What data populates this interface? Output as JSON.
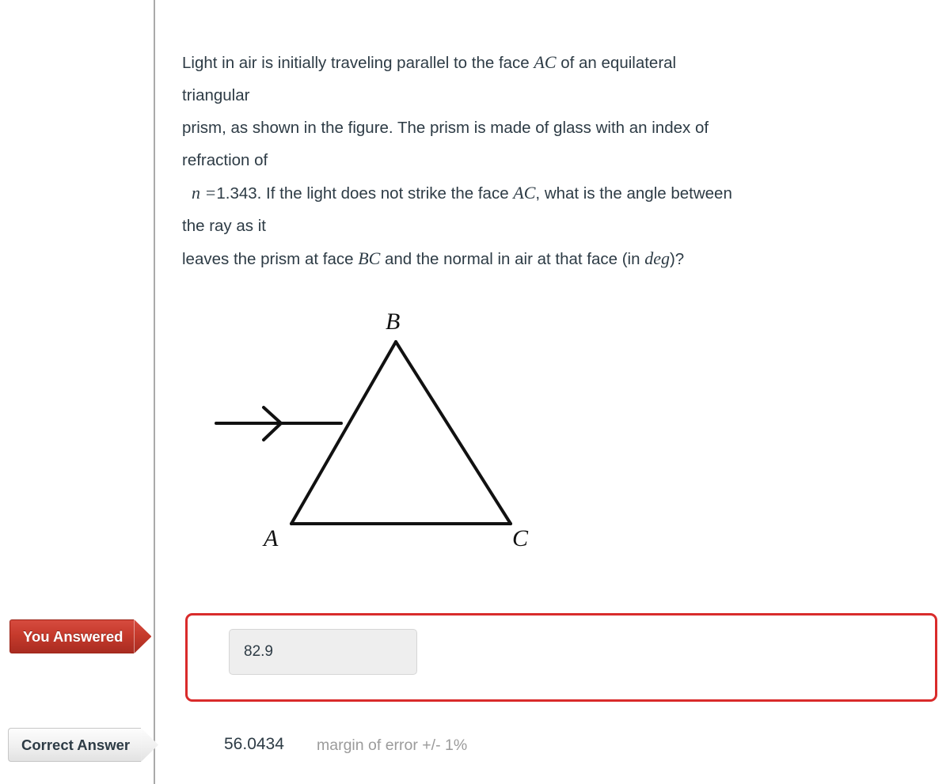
{
  "question": {
    "lines": [
      {
        "id": "l1",
        "pre": "Light in air is initially traveling parallel to the  face ",
        "math": "AC",
        "post": " of an equilateral"
      },
      {
        "id": "l2",
        "pre": "triangular",
        "math": "",
        "post": ""
      },
      {
        "id": "l3",
        "pre": "prism, as shown in the figure. The prism is made of glass with an index of",
        "math": "",
        "post": ""
      },
      {
        "id": "l4",
        "pre": "refraction of",
        "math": "",
        "post": ""
      },
      {
        "id": "l5",
        "pre": "",
        "math": "n =",
        "post": "1.343.  If the light does not strike the face ",
        "math2": "AC",
        "post2": ", what is the angle between"
      },
      {
        "id": "l6",
        "pre": "the ray as it",
        "math": "",
        "post": ""
      },
      {
        "id": "l7",
        "pre": "leaves the prism at face ",
        "math": "BC",
        "post": " and the normal in air at that face  (in ",
        "math2": "deg",
        "post2": ")?"
      }
    ],
    "index_of_refraction": "1.343"
  },
  "figure": {
    "caption": "equilateral triangular prism with incident light ray",
    "vertices": {
      "A": "A",
      "B": "B",
      "C": "C"
    },
    "stroke_color": "#111111"
  },
  "answer": {
    "you_answered_label": "You Answered",
    "student_value": "82.9"
  },
  "correct": {
    "correct_answer_label": "Correct Answer",
    "value": "56.0434",
    "margin_text": "margin of error +/- 1%"
  },
  "colors": {
    "incorrect_red": "#d92b2b",
    "badge_red": "#c63a2c",
    "text": "#2D3B45",
    "muted": "#9b9b9b"
  }
}
